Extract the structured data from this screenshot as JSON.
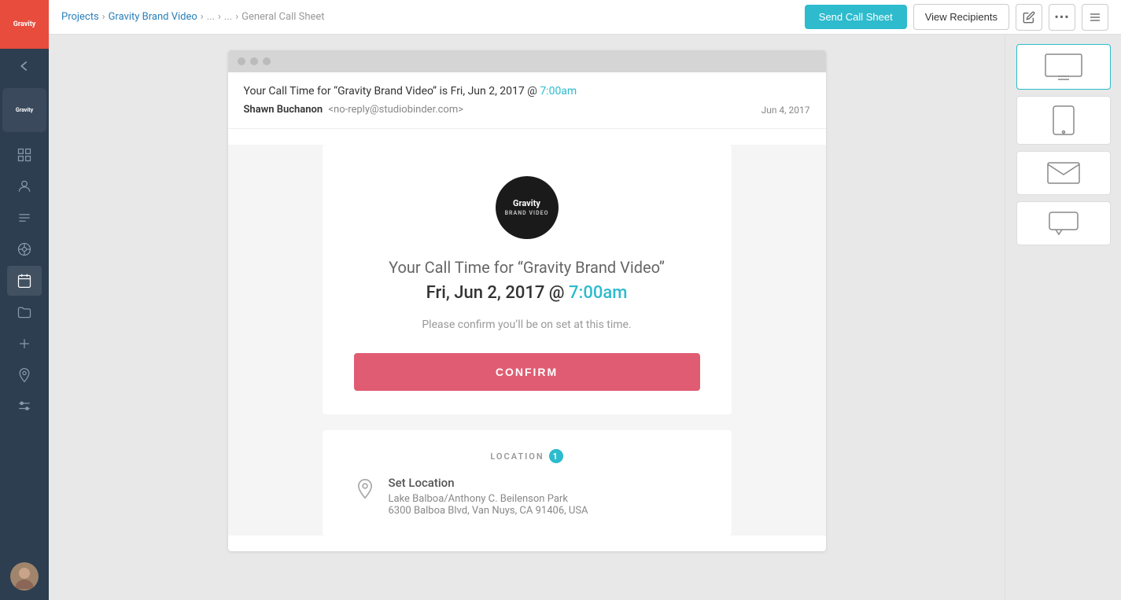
{
  "app": {
    "logo_text": "Gravity",
    "project_label": "Gravity"
  },
  "topbar": {
    "breadcrumb": {
      "projects": "Projects",
      "project": "Gravity Brand Video",
      "sep1": "...",
      "sep2": "...",
      "page": "General Call Sheet"
    },
    "send_btn": "Send Call Sheet",
    "view_recipients_btn": "View Recipients"
  },
  "email": {
    "subject": "Your Call Time for “Gravity Brand Video” is Fri, Jun 2, 2017 @",
    "subject_time": "7:00am",
    "from_name": "Shawn Buchanon",
    "from_address": "<no-reply@studiobinder.com>",
    "date": "Jun 4, 2017",
    "card": {
      "logo_line1": "Gravity",
      "logo_line2": "BRAND VIDEO",
      "title": "Your Call Time for “Gravity Brand Video”",
      "date": "Fri, Jun 2, 2017 @",
      "time": "7:00am",
      "confirm_msg": "Please confirm you’ll be on set at this time.",
      "confirm_btn": "CONFIRM"
    },
    "location": {
      "header": "LOCATION",
      "badge": "1",
      "name": "Set Location",
      "address_line1": "Lake Balboa/Anthony C. Beilenson Park",
      "address_line2": "6300 Balboa Blvd, Van Nuys, CA 91406, USA"
    }
  },
  "sidebar": {
    "nav_items": [
      {
        "name": "dashboard",
        "label": "Dashboard"
      },
      {
        "name": "contacts",
        "label": "Contacts"
      },
      {
        "name": "schedule",
        "label": "Schedule"
      },
      {
        "name": "wheel",
        "label": "Wheel"
      },
      {
        "name": "calendar",
        "label": "Calendar"
      },
      {
        "name": "folder",
        "label": "Folder"
      },
      {
        "name": "plus",
        "label": "Add"
      },
      {
        "name": "location",
        "label": "Location"
      },
      {
        "name": "filters",
        "label": "Filters"
      }
    ]
  },
  "colors": {
    "accent": "#2dbbcd",
    "confirm": "#e05c72",
    "sidebar_bg": "#2c3e50",
    "logo_bg": "#e74c3c"
  }
}
